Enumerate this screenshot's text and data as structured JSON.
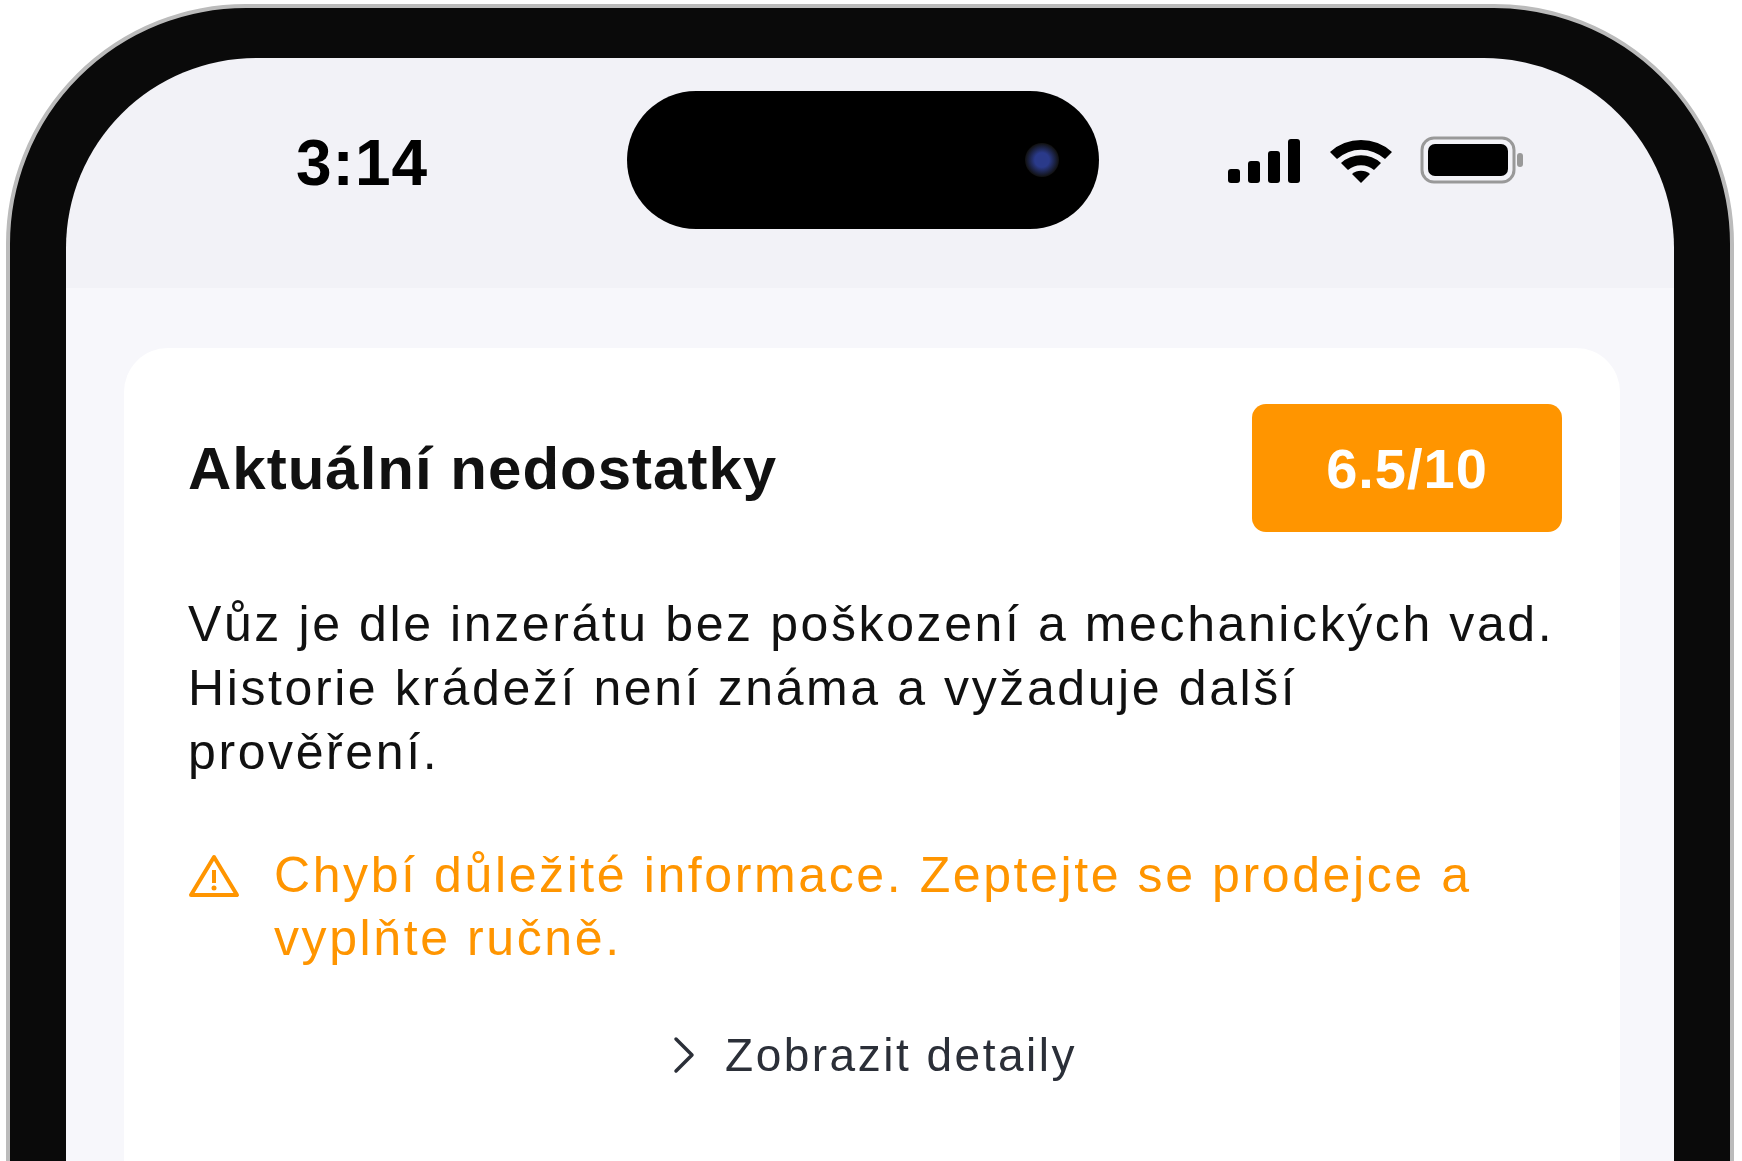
{
  "status_bar": {
    "time": "3:14"
  },
  "card": {
    "title": "Aktuální nedostatky",
    "score": "6.5/10",
    "description": "Vůz je dle inzerátu bez poškození a mechanických vad. Historie krádeží není známa a vyžaduje další prověření.",
    "warning": {
      "text": "Chybí důležité informace. Zeptejte se prodejce a vyplňte ručně."
    },
    "details_link": {
      "label": "Zobrazit detaily"
    }
  }
}
